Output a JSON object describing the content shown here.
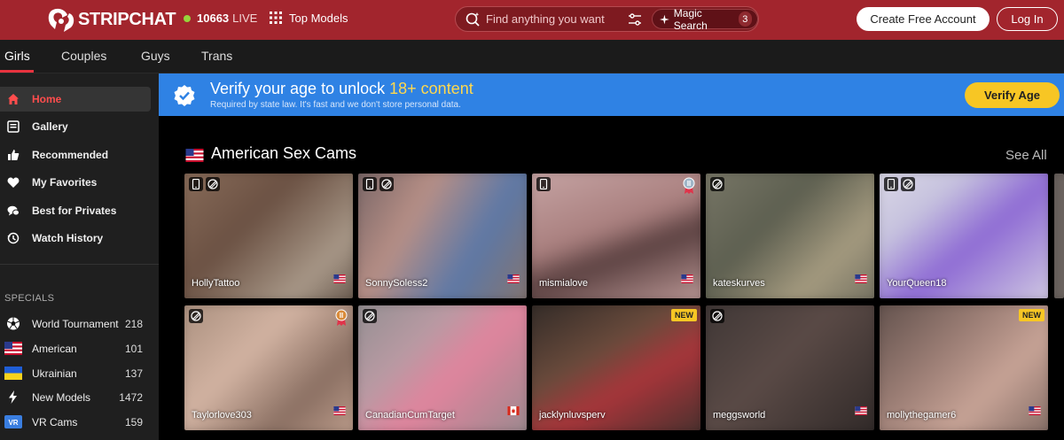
{
  "header": {
    "logo_text": "STRIPCHAT",
    "live_count": "10663",
    "live_label": "LIVE",
    "top_models_label": "Top Models",
    "search_placeholder": "Find anything you want",
    "magic_search_label": "Magic Search",
    "magic_search_count": "3",
    "create_account_label": "Create Free Account",
    "login_label": "Log In",
    "brand_color": "#a2252d"
  },
  "tabs": [
    {
      "label": "Girls",
      "active": true
    },
    {
      "label": "Couples"
    },
    {
      "label": "Guys"
    },
    {
      "label": "Trans"
    }
  ],
  "sidebar": {
    "nav": [
      {
        "label": "Home",
        "icon": "home-icon",
        "active": true
      },
      {
        "label": "Gallery",
        "icon": "gallery-icon"
      },
      {
        "label": "Recommended",
        "icon": "thumbs-up-icon"
      },
      {
        "label": "My Favorites",
        "icon": "heart-icon"
      },
      {
        "label": "Best for Privates",
        "icon": "chat-icon"
      },
      {
        "label": "Watch History",
        "icon": "history-icon"
      }
    ],
    "specials_title": "SPECIALS",
    "specials": [
      {
        "label": "World Tournament",
        "count": "218",
        "icon": "soccer-ball-icon"
      },
      {
        "label": "American",
        "count": "101",
        "icon": "us-flag-icon"
      },
      {
        "label": "Ukrainian",
        "count": "137",
        "icon": "ua-flag-icon"
      },
      {
        "label": "New Models",
        "count": "1472",
        "icon": "lightning-icon"
      },
      {
        "label": "VR Cams",
        "count": "159",
        "icon": "vr-icon"
      }
    ]
  },
  "verify_banner": {
    "title_prefix": "Verify your age to unlock",
    "title_highlight": "18+ content",
    "subtitle": "Required by state law. It's fast and we don't store personal data.",
    "button_label": "Verify Age",
    "banner_color": "#2f82e4",
    "button_color": "#f7c624"
  },
  "section": {
    "title": "American Sex Cams",
    "see_all_label": "See All"
  },
  "cards": [
    {
      "name": "HollyTattoo",
      "flag": "us",
      "icons": [
        "mobile-icon",
        "hd-icon"
      ],
      "bg": "linear-gradient(135deg,#8c6f5c 0%,#6b5143 40%,#a89888 75%,#5a4a40 100%)"
    },
    {
      "name": "SonnySoless2",
      "flag": "us",
      "icons": [
        "mobile-icon",
        "hd-icon"
      ],
      "bg": "linear-gradient(120deg,#6e5f61 0%,#b78f86 35%,#5d78a6 65%,#8a7468 100%)"
    },
    {
      "name": "mismialove",
      "flag": "us",
      "icons": [
        "mobile-icon"
      ],
      "medal": "silver",
      "bg": "linear-gradient(160deg,#c9a8a8 0%,#a97f7e 45%,#5a4040 60%,#c8a3a1 100%)"
    },
    {
      "name": "kateskurves",
      "flag": "us",
      "icons": [
        "hd-icon"
      ],
      "bg": "linear-gradient(135deg,#7c7a6a 0%,#5d5f50 40%,#a49a7f 70%,#6c6a5c 100%)"
    },
    {
      "name": "YourQueen18",
      "flag": "",
      "icons": [
        "mobile-icon",
        "hd-icon"
      ],
      "bg": "linear-gradient(140deg,#dedce8 0%,#c6c2de 30%,#8e6bd4 55%,#d7d3e3 100%)"
    },
    {
      "name": "Taylorlove303",
      "flag": "us",
      "icons": [
        "hd-icon"
      ],
      "medal": "bronze",
      "bg": "linear-gradient(135deg,#a48a79 0%,#d2b3a2 40%,#8a6f62 70%,#c6a593 100%)"
    },
    {
      "name": "CanadianCumTarget",
      "flag": "ca",
      "icons": [
        "hd-icon"
      ],
      "bg": "linear-gradient(135deg,#8d8d8f 0%,#b99aa3 35%,#e0849d 55%,#938a8d 100%)"
    },
    {
      "name": "jacklynluvsperv",
      "flag": "",
      "icons": [],
      "new": true,
      "bg": "linear-gradient(150deg,#2a2624 0%,#6a4b3c 40%,#a8353a 60%,#3b302c 100%)"
    },
    {
      "name": "meggsworld",
      "flag": "us",
      "icons": [
        "hd-icon"
      ],
      "bg": "linear-gradient(135deg,#3b3433 0%,#5a4a46 45%,#2c2625 100%)"
    },
    {
      "name": "mollythegamer6",
      "flag": "us",
      "icons": [],
      "new": true,
      "bg": "linear-gradient(135deg,#5a4b47 0%,#9d7f76 40%,#c7a396 65%,#7a655e 100%)"
    }
  ],
  "new_badge_label": "NEW"
}
